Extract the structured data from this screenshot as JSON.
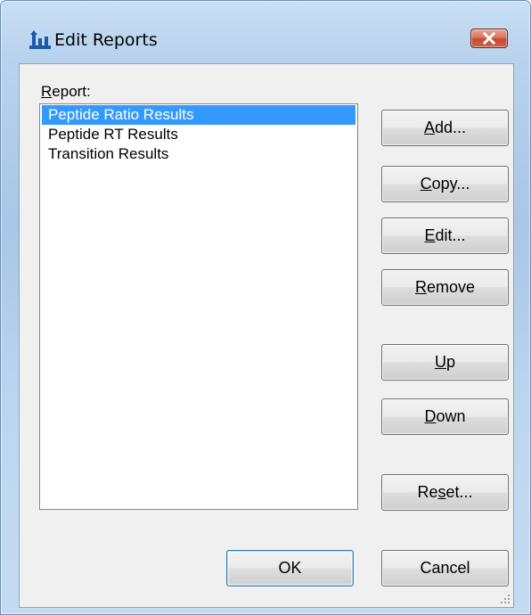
{
  "window": {
    "title": "Edit Reports"
  },
  "report_label": {
    "pre": "",
    "key": "R",
    "post": "eport:"
  },
  "reports": [
    "Peptide Ratio Results",
    "Peptide RT Results",
    "Transition Results"
  ],
  "selected_index": 0,
  "buttons": {
    "add": {
      "pre": "",
      "key": "A",
      "post": "dd..."
    },
    "copy": {
      "pre": "",
      "key": "C",
      "post": "opy..."
    },
    "edit": {
      "pre": "",
      "key": "E",
      "post": "dit..."
    },
    "remove": {
      "pre": "",
      "key": "R",
      "post": "emove"
    },
    "up": {
      "pre": "",
      "key": "U",
      "post": "p"
    },
    "down": {
      "pre": "",
      "key": "D",
      "post": "own"
    },
    "reset": {
      "pre": "Re",
      "key": "s",
      "post": "et..."
    },
    "ok": {
      "pre": "OK",
      "key": "",
      "post": ""
    },
    "cancel": {
      "pre": "Cancel",
      "key": "",
      "post": ""
    }
  },
  "colors": {
    "selection": "#3399ff",
    "close_button": "#c64a30"
  }
}
